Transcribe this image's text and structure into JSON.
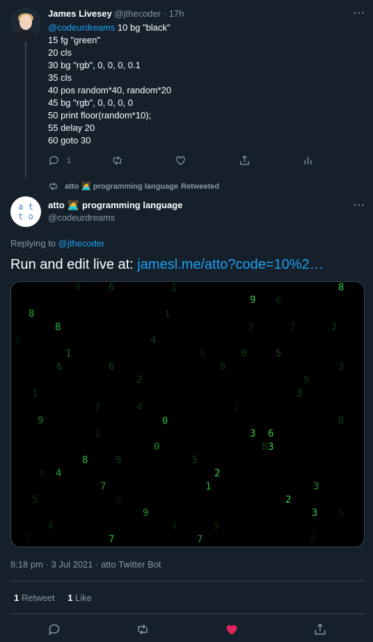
{
  "reply_tweet": {
    "author_name": "James Livesey",
    "author_handle": "@jthecoder",
    "time": "· 17h",
    "mention": "@codeurdreams",
    "first_line_rest": " 10 bg \"black\"",
    "code_lines": [
      "15 fg \"green\"",
      "20 cls",
      "30 bg \"rgb\", 0, 0, 0, 0.1",
      "35 cls",
      "40 pos random*40, random*20",
      "45 bg \"rgb\", 0, 0, 0, 0",
      "50 print floor(random*10);",
      "55 delay 20",
      "60 goto 30"
    ],
    "reply_count": "1",
    "icons": [
      "reply-icon",
      "retweet-icon",
      "like-icon",
      "share-icon",
      "analytics-icon"
    ]
  },
  "retweet_context": {
    "retweeter": "atto",
    "emoji": "🧑‍💻",
    "retweeter_rest": "programming language",
    "suffix": "Retweeted"
  },
  "main_tweet": {
    "avatar_text_1": "a t",
    "avatar_text_2": "t o",
    "author_name": "atto",
    "author_emoji": "🧑‍💻",
    "author_name_rest": "programming language",
    "author_handle": "@codeurdreams",
    "replying_prefix": "Replying to ",
    "replying_to": "@jthecoder",
    "body_text": "Run and edit live at: ",
    "body_link": "jamesl.me/atto?code=10%2…",
    "timestamp": "8:18 pm · 3 Jul 2021 · atto Twitter Bot",
    "retweet_count": "1",
    "retweet_label": "Retweet",
    "like_count": "1",
    "like_label": "Like"
  },
  "media_digits": [
    {
      "d": "8",
      "b": 1
    },
    {
      "d": "9",
      "b": 1
    },
    {
      "d": "8",
      "b": 0.8
    },
    {
      "d": "8",
      "b": 0.9
    },
    {
      "d": "1",
      "b": 0.5
    },
    {
      "d": "0",
      "b": 0.9
    },
    {
      "d": "3",
      "b": 1
    },
    {
      "d": "6",
      "b": 1
    },
    {
      "d": "3",
      "b": 1
    },
    {
      "d": "0",
      "b": 0.7
    },
    {
      "d": "9",
      "b": 0.6
    },
    {
      "d": "8",
      "b": 0.9
    },
    {
      "d": "4",
      "b": 0.8
    },
    {
      "d": "2",
      "b": 1
    },
    {
      "d": "7",
      "b": 0.7
    },
    {
      "d": "1",
      "b": 0.9
    },
    {
      "d": "3",
      "b": 0.7
    },
    {
      "d": "2",
      "b": 1
    },
    {
      "d": "9",
      "b": 0.7
    },
    {
      "d": "3",
      "b": 1
    },
    {
      "d": "7",
      "b": 0.9
    },
    {
      "d": "7",
      "b": 0.7
    },
    {
      "d": "6",
      "b": 0.35
    },
    {
      "d": "6",
      "b": 0.3
    },
    {
      "d": "2",
      "b": 0.3
    },
    {
      "d": "5",
      "b": 0.3
    },
    {
      "d": "1",
      "b": 0.25
    },
    {
      "d": "4",
      "b": 0.25
    },
    {
      "d": "0",
      "b": 0.3
    },
    {
      "d": "3",
      "b": 0.25
    },
    {
      "d": "9",
      "b": 0.25
    },
    {
      "d": "5",
      "b": 0.35
    },
    {
      "d": "8",
      "b": 0.3
    },
    {
      "d": "1",
      "b": 0.3
    },
    {
      "d": "7",
      "b": 0.25
    },
    {
      "d": "2",
      "b": 0.3
    },
    {
      "d": "4",
      "b": 0.3
    },
    {
      "d": "6",
      "b": 0.35
    },
    {
      "d": "0",
      "b": 0.25
    },
    {
      "d": "9",
      "b": 0.3
    },
    {
      "d": "3",
      "b": 0.35
    },
    {
      "d": "5",
      "b": 0.25
    },
    {
      "d": "1",
      "b": 0.25
    },
    {
      "d": "8",
      "b": 0.3
    },
    {
      "d": "0",
      "b": 0.2
    },
    {
      "d": "6",
      "b": 0.25
    },
    {
      "d": "2",
      "b": 0.2
    },
    {
      "d": "4",
      "b": 0.2
    },
    {
      "d": "7",
      "b": 0.2
    },
    {
      "d": "9",
      "b": 0.2
    },
    {
      "d": "1",
      "b": 0.15
    },
    {
      "d": "3",
      "b": 0.2
    },
    {
      "d": "5",
      "b": 0.2
    },
    {
      "d": "8",
      "b": 0.15
    },
    {
      "d": "0",
      "b": 0.15
    },
    {
      "d": "6",
      "b": 0.15
    },
    {
      "d": "2",
      "b": 0.15
    },
    {
      "d": "4",
      "b": 0.15
    },
    {
      "d": "7",
      "b": 0.15
    },
    {
      "d": "9",
      "b": 0.15
    }
  ],
  "colors": {
    "background": "#15202b",
    "accent": "#1da1f2",
    "like": "#e0245e",
    "terminal_green": "#33cc44"
  }
}
